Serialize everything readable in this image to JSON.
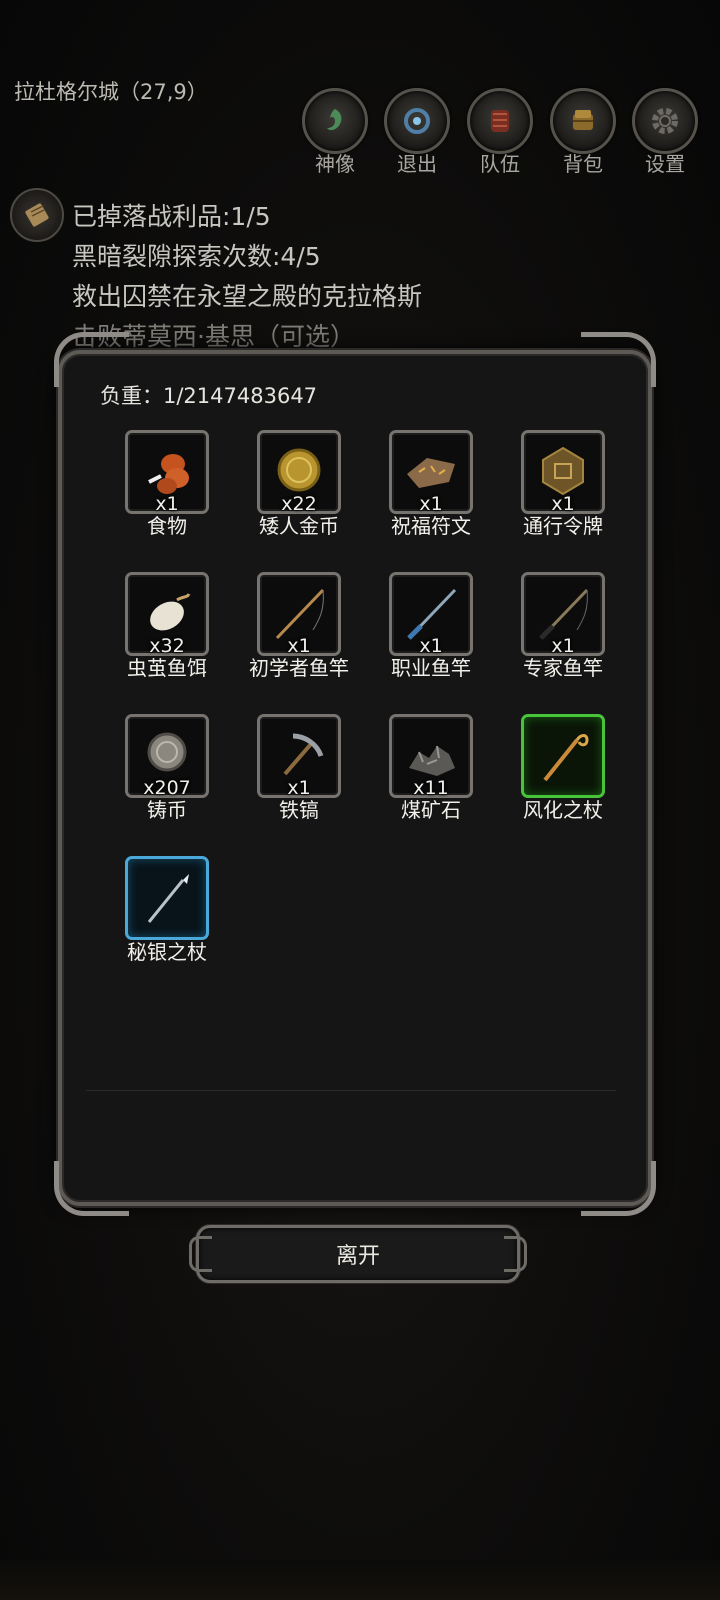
{
  "location": "拉杜格尔城（27,9）",
  "nav": [
    {
      "label": "神像",
      "icon": "statue-icon"
    },
    {
      "label": "退出",
      "icon": "exit-portal-icon"
    },
    {
      "label": "队伍",
      "icon": "party-icon"
    },
    {
      "label": "背包",
      "icon": "backpack-icon"
    },
    {
      "label": "设置",
      "icon": "gear-icon"
    }
  ],
  "quests": [
    "已掉落战利品:1/5",
    "黑暗裂隙探索次数:4/5",
    "救出囚禁在永望之殿的克拉格斯",
    "击败蒂莫西·基思（可选）"
  ],
  "inventory": {
    "weight_label": "负重：1/2147483647",
    "items": [
      {
        "name": "食物",
        "qty": "x1",
        "icon": "meat-icon"
      },
      {
        "name": "矮人金币",
        "qty": "x22",
        "icon": "gold-coin-icon"
      },
      {
        "name": "祝福符文",
        "qty": "x1",
        "icon": "rune-stone-icon"
      },
      {
        "name": "通行令牌",
        "qty": "x1",
        "icon": "pass-token-icon"
      },
      {
        "name": "虫茧鱼饵",
        "qty": "x32",
        "icon": "cocoon-bait-icon"
      },
      {
        "name": "初学者鱼竿",
        "qty": "x1",
        "icon": "fishing-rod-icon"
      },
      {
        "name": "职业鱼竿",
        "qty": "x1",
        "icon": "fishing-rod-icon"
      },
      {
        "name": "专家鱼竿",
        "qty": "x1",
        "icon": "fishing-rod-icon"
      },
      {
        "name": "铸币",
        "qty": "x207",
        "icon": "silver-coin-icon"
      },
      {
        "name": "铁镐",
        "qty": "x1",
        "icon": "pickaxe-icon"
      },
      {
        "name": "煤矿石",
        "qty": "x11",
        "icon": "coal-ore-icon"
      },
      {
        "name": "风化之杖",
        "qty": "",
        "icon": "wooden-staff-icon",
        "rarity": "green"
      },
      {
        "name": "秘银之杖",
        "qty": "",
        "icon": "mithril-staff-icon",
        "rarity": "blue"
      }
    ]
  },
  "leave_button": "离开"
}
